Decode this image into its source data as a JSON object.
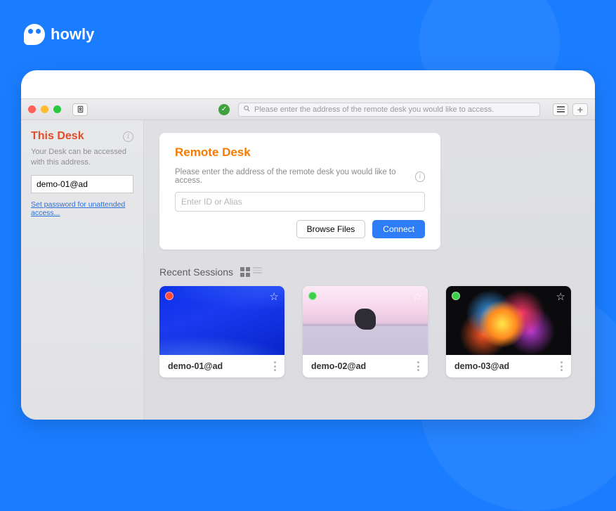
{
  "brand": {
    "name": "howly"
  },
  "titlebar": {
    "search_placeholder": "Please enter the address of the remote desk you would like to access."
  },
  "sidebar": {
    "title": "This Desk",
    "description": "Your Desk can be accessed with this address.",
    "address_value": "demo-01@ad",
    "password_link": "Set password for unattended access..."
  },
  "remote": {
    "title": "Remote Desk",
    "description": "Please enter the address of the remote desk you would like to access.",
    "input_placeholder": "Enter ID or Alias",
    "browse_label": "Browse Files",
    "connect_label": "Connect"
  },
  "recent": {
    "title": "Recent Sessions",
    "items": [
      {
        "label": "demo-01@ad",
        "status": "offline",
        "thumb": "blue-wave"
      },
      {
        "label": "demo-02@ad",
        "status": "online",
        "thumb": "seascape"
      },
      {
        "label": "demo-03@ad",
        "status": "online",
        "thumb": "explosion"
      }
    ]
  }
}
